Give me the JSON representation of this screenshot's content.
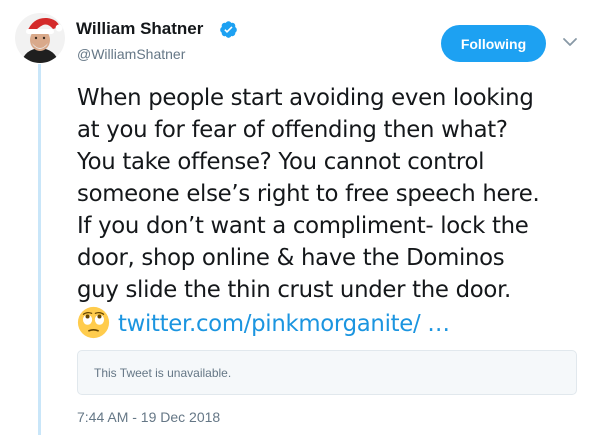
{
  "author": {
    "display_name": "William Shatner",
    "handle": "@WilliamShatner",
    "verified": true,
    "avatar_icon": "avatar-santa-hat-icon"
  },
  "follow_button": {
    "label": "Following",
    "color": "#1da1f2"
  },
  "menu": {
    "icon": "chevron-down-icon"
  },
  "tweet": {
    "lines": [
      "When people start avoiding even looking",
      "at you for fear of offending then what?",
      "You take offense? You cannot control",
      "someone else’s right to free speech here.",
      "If you don’t want a compliment- lock the",
      "door, shop online & have the Dominos",
      "guy slide the thin crust under the door."
    ],
    "emoji": "eye-roll-emoji-icon",
    "link_text": "twitter.com/pinkmorganite/ …",
    "link_color": "#1b95e0"
  },
  "quoted_tweet": {
    "text": "This Tweet is unavailable."
  },
  "timestamp": "7:44 AM - 19 Dec 2018",
  "colors": {
    "text": "#14171a",
    "secondary": "#657786",
    "thread_line": "#c9e6f9",
    "card_bg": "#f5f8fa",
    "card_border": "#e1e8ed"
  }
}
